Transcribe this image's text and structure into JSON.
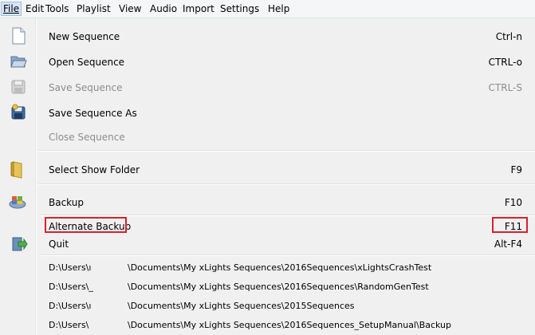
{
  "menubar": {
    "items": [
      "File",
      "Edit",
      "Tools",
      "Playlist",
      "View",
      "Audio",
      "Import",
      "Settings",
      "Help"
    ]
  },
  "file_menu": {
    "items": [
      {
        "label": "New Sequence",
        "accel": "Ctrl-n",
        "enabled": true,
        "icon": "new-document-icon"
      },
      {
        "label": "Open Sequence",
        "accel": "CTRL-o",
        "enabled": true,
        "icon": "open-folder-icon"
      },
      {
        "label": "Save Sequence",
        "accel": "CTRL-S",
        "enabled": false,
        "icon": "save-icon"
      },
      {
        "label": "Save Sequence As",
        "accel": "",
        "enabled": true,
        "icon": "save-as-icon"
      },
      {
        "label": "Close Sequence",
        "accel": "",
        "enabled": false,
        "icon": ""
      },
      {
        "label": "Select Show Folder",
        "accel": "F9",
        "enabled": true,
        "icon": "folder-icon"
      },
      {
        "label": "Backup",
        "accel": "F10",
        "enabled": true,
        "icon": "backup-icon"
      },
      {
        "label": "Alternate Backup",
        "accel": "F11",
        "enabled": true,
        "icon": ""
      },
      {
        "label": "Quit",
        "accel": "Alt-F4",
        "enabled": true,
        "icon": "quit-icon"
      }
    ],
    "recent": [
      {
        "drive": "D:\\Users\\ı",
        "path": "\\Documents\\My xLights Sequences\\2016Sequences\\xLightsCrashTest"
      },
      {
        "drive": "D:\\Users\\_",
        "path": "\\Documents\\My xLights Sequences\\2016Sequences\\RandomGenTest"
      },
      {
        "drive": "D:\\Users\\ı",
        "path": "\\Documents\\My xLights Sequences\\2015Sequences"
      },
      {
        "drive": "D:\\Users\\",
        "path": "\\Documents\\My xLights Sequences\\2016Sequences_SetupManual\\Backup"
      }
    ]
  },
  "colors": {
    "highlight_box": "#d9202e",
    "menu_bg": "#f0f0f0",
    "disabled_text": "#8d8d8d"
  }
}
